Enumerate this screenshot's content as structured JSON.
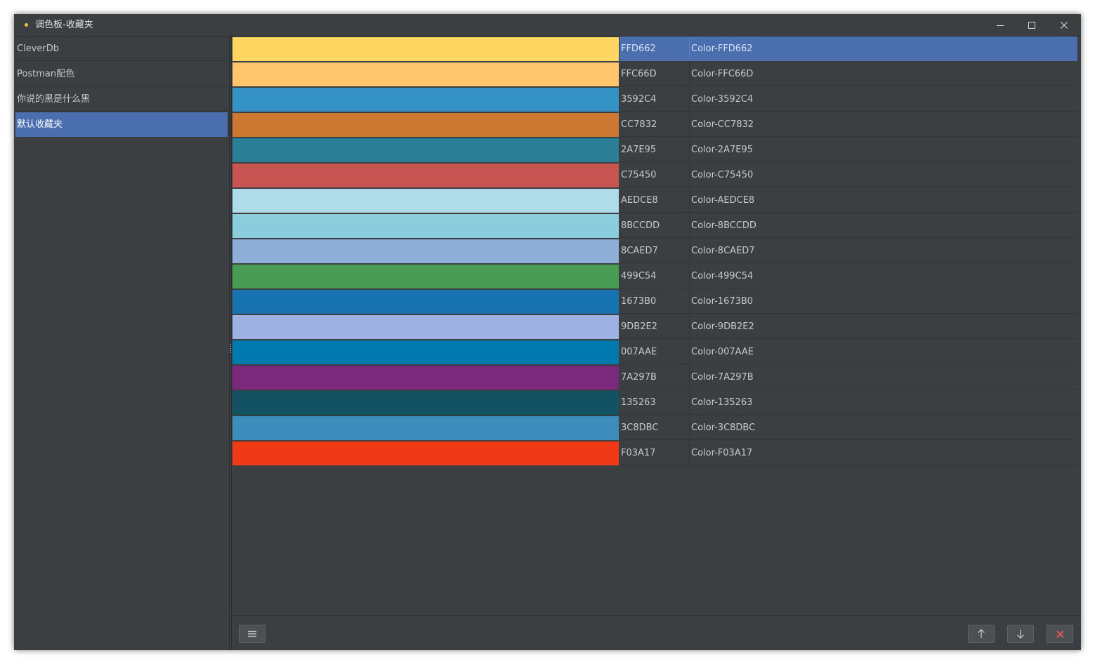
{
  "window": {
    "title": "调色板-收藏夹",
    "accent_color": "#4b6eaf",
    "title_dot_color": "#e8c63a"
  },
  "sidebar": {
    "items": [
      {
        "label": "CleverDb",
        "selected": false
      },
      {
        "label": "Postman配色",
        "selected": false
      },
      {
        "label": "你说的黑是什么黑",
        "selected": false
      },
      {
        "label": "默认收藏夹",
        "selected": true
      }
    ]
  },
  "table": {
    "rows": [
      {
        "color": "#FFD662",
        "hex": "FFD662",
        "name": "Color-FFD662",
        "selected": true
      },
      {
        "color": "#FFC66D",
        "hex": "FFC66D",
        "name": "Color-FFC66D",
        "selected": false
      },
      {
        "color": "#3592C4",
        "hex": "3592C4",
        "name": "Color-3592C4",
        "selected": false
      },
      {
        "color": "#CC7832",
        "hex": "CC7832",
        "name": "Color-CC7832",
        "selected": false
      },
      {
        "color": "#2A7E95",
        "hex": "2A7E95",
        "name": "Color-2A7E95",
        "selected": false
      },
      {
        "color": "#C75450",
        "hex": "C75450",
        "name": "Color-C75450",
        "selected": false
      },
      {
        "color": "#AEDCE8",
        "hex": "AEDCE8",
        "name": "Color-AEDCE8",
        "selected": false
      },
      {
        "color": "#8BCCDD",
        "hex": "8BCCDD",
        "name": "Color-8BCCDD",
        "selected": false
      },
      {
        "color": "#8CAED7",
        "hex": "8CAED7",
        "name": "Color-8CAED7",
        "selected": false
      },
      {
        "color": "#499C54",
        "hex": "499C54",
        "name": "Color-499C54",
        "selected": false
      },
      {
        "color": "#1673B0",
        "hex": "1673B0",
        "name": "Color-1673B0",
        "selected": false
      },
      {
        "color": "#9DB2E2",
        "hex": "9DB2E2",
        "name": "Color-9DB2E2",
        "selected": false
      },
      {
        "color": "#007AAE",
        "hex": "007AAE",
        "name": "Color-007AAE",
        "selected": false
      },
      {
        "color": "#7A297B",
        "hex": "7A297B",
        "name": "Color-7A297B",
        "selected": false
      },
      {
        "color": "#135263",
        "hex": "135263",
        "name": "Color-135263",
        "selected": false
      },
      {
        "color": "#3C8DBC",
        "hex": "3C8DBC",
        "name": "Color-3C8DBC",
        "selected": false
      },
      {
        "color": "#F03A17",
        "hex": "F03A17",
        "name": "Color-F03A17",
        "selected": false
      }
    ]
  },
  "footer": {
    "buttons": [
      {
        "name": "menu-button",
        "icon": "hamburger-menu-icon"
      },
      {
        "name": "move-up-button",
        "icon": "arrow-up-icon"
      },
      {
        "name": "move-down-button",
        "icon": "arrow-down-icon"
      },
      {
        "name": "delete-button",
        "icon": "red-x-icon",
        "icon_color": "#e05555"
      }
    ]
  }
}
